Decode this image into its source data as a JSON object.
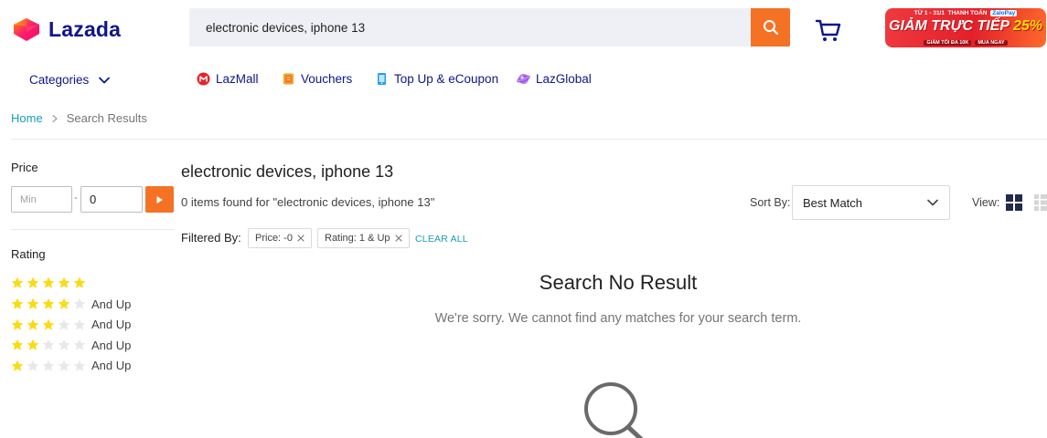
{
  "header": {
    "logo_text": "Lazada",
    "search": {
      "value": "electronic devices, iphone 13",
      "placeholder": ""
    },
    "brand_color": "#f57224",
    "promo": {
      "top_line_date": "TỪ 1 - 31/1",
      "top_line_pay": "THANH TOÁN",
      "top_line_brand": "ZaloPay",
      "headline": "GIẢM TRỰC TIẾP",
      "percent": "25%",
      "foot_left": "GIẢM TỐI ĐA 10K",
      "foot_right": "MUA NGAY"
    }
  },
  "nav": {
    "categories_label": "Categories",
    "items": [
      {
        "label": "LazMall",
        "icon": "lazmall-icon"
      },
      {
        "label": "Vouchers",
        "icon": "voucher-icon"
      },
      {
        "label": "Top Up & eCoupon",
        "icon": "topup-icon"
      },
      {
        "label": "LazGlobal",
        "icon": "lazglobal-icon"
      }
    ]
  },
  "breadcrumb": {
    "home": "Home",
    "current": "Search Results"
  },
  "sidebar": {
    "price": {
      "title": "Price",
      "min_placeholder": "Min",
      "max_value": "0",
      "separator": "-"
    },
    "rating": {
      "title": "Rating",
      "rows": [
        {
          "stars": 5,
          "label": ""
        },
        {
          "stars": 4,
          "label": "And Up"
        },
        {
          "stars": 3,
          "label": "And Up"
        },
        {
          "stars": 2,
          "label": "And Up"
        },
        {
          "stars": 1,
          "label": "And Up"
        }
      ]
    }
  },
  "results": {
    "title": "electronic devices, iphone 13",
    "count_text": "0 items found for \"electronic devices, iphone 13\"",
    "sort_label": "Sort By:",
    "sort_value": "Best Match",
    "view_label": "View:",
    "filtered_label": "Filtered By:",
    "filters": [
      {
        "label": "Price: -0"
      },
      {
        "label": "Rating: 1 & Up"
      }
    ],
    "clear_all": "CLEAR ALL",
    "empty_title": "Search No Result",
    "empty_message": "We're sorry. We cannot find any matches for your search term."
  }
}
